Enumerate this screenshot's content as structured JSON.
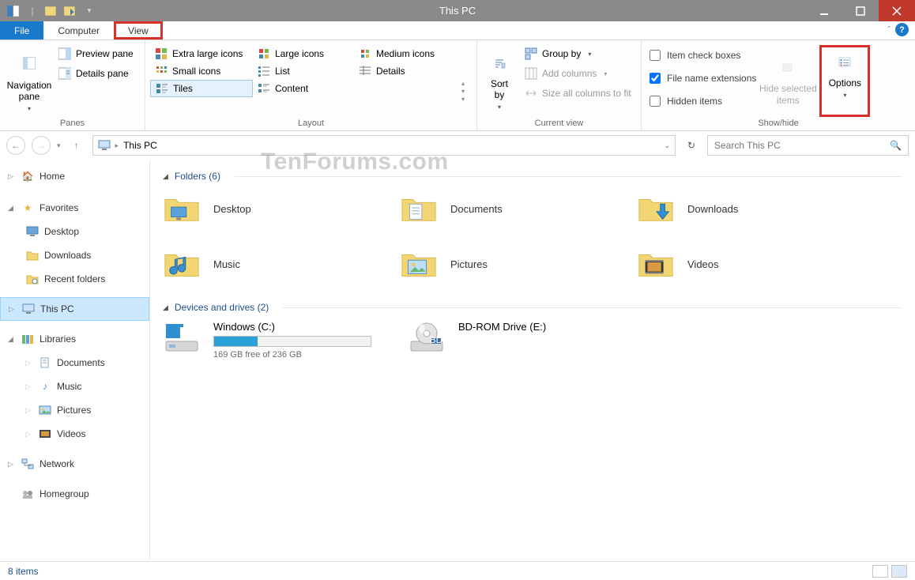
{
  "window": {
    "title": "This PC"
  },
  "tabs": {
    "file": "File",
    "computer": "Computer",
    "view": "View"
  },
  "ribbon": {
    "panes": {
      "nav_pane": "Navigation\npane",
      "preview": "Preview pane",
      "details": "Details pane",
      "label": "Panes"
    },
    "layout": {
      "xl_icons": "Extra large icons",
      "large_icons": "Large icons",
      "medium_icons": "Medium icons",
      "small_icons": "Small icons",
      "list": "List",
      "details": "Details",
      "tiles": "Tiles",
      "content": "Content",
      "label": "Layout"
    },
    "current_view": {
      "sort_by": "Sort\nby",
      "group_by": "Group by",
      "add_columns": "Add columns",
      "size_columns": "Size all columns to fit",
      "label": "Current view"
    },
    "showhide": {
      "item_check": "Item check boxes",
      "file_ext": "File name extensions",
      "hidden": "Hidden items",
      "hide_selected": "Hide selected\nitems",
      "options": "Options",
      "label": "Show/hide"
    }
  },
  "breadcrumb": {
    "location": "This PC"
  },
  "search": {
    "placeholder": "Search This PC"
  },
  "tree": {
    "home": "Home",
    "favorites": "Favorites",
    "desktop": "Desktop",
    "downloads": "Downloads",
    "recent": "Recent folders",
    "this_pc": "This PC",
    "libraries": "Libraries",
    "documents": "Documents",
    "music": "Music",
    "pictures": "Pictures",
    "videos": "Videos",
    "network": "Network",
    "homegroup": "Homegroup"
  },
  "sections": {
    "folders_head": "Folders (6)",
    "devices_head": "Devices and drives (2)"
  },
  "folders": {
    "desktop": "Desktop",
    "documents": "Documents",
    "downloads": "Downloads",
    "music": "Music",
    "pictures": "Pictures",
    "videos": "Videos"
  },
  "drives": {
    "c": {
      "label": "Windows (C:)",
      "free": "169 GB free of 236 GB",
      "fill_pct": 28
    },
    "e": {
      "label": "BD-ROM Drive (E:)"
    }
  },
  "status": {
    "items": "8 items"
  },
  "watermark": "TenForums.com"
}
